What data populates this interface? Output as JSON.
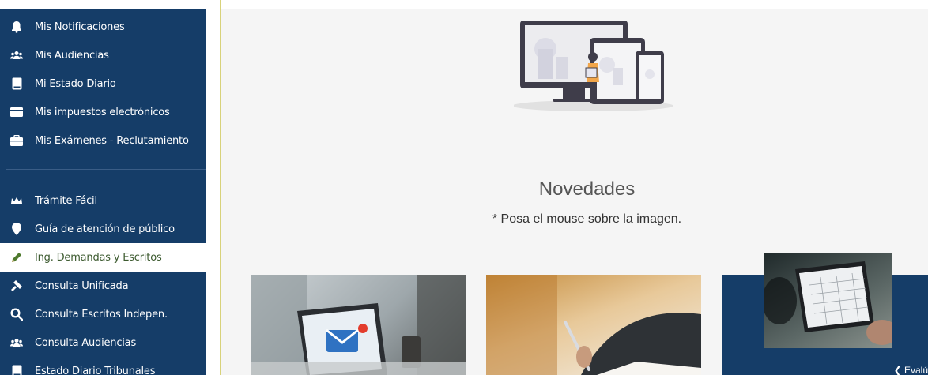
{
  "sidebar": {
    "items": [
      {
        "label": "Mis Notificaciones",
        "icon": "bell-icon"
      },
      {
        "label": "Mis Audiencias",
        "icon": "users-icon"
      },
      {
        "label": "Mi Estado Diario",
        "icon": "book-icon"
      },
      {
        "label": "Mis impuestos electrónicos",
        "icon": "credit-card-icon"
      },
      {
        "label": "Mis Exámenes - Reclutamiento",
        "icon": "briefcase-icon"
      },
      {
        "label": "Trámite Fácil",
        "icon": "crown-icon"
      },
      {
        "label": "Guía de atención de público",
        "icon": "map-marker-icon"
      },
      {
        "label": "Ing. Demandas y Escritos",
        "icon": "pencil-icon"
      },
      {
        "label": "Consulta Unificada",
        "icon": "gavel-icon"
      },
      {
        "label": "Consulta Escritos Indepen.",
        "icon": "search-icon"
      },
      {
        "label": "Consulta Audiencias",
        "icon": "users-icon"
      },
      {
        "label": "Estado Diario Tribunales",
        "icon": "book-icon"
      }
    ],
    "active_label": "Ing. Demandas y Escritos"
  },
  "main": {
    "section_title": "Novedades",
    "section_subtitle": "* Posa el mouse sobre la imagen.",
    "carousel_next_label": "Evalú"
  },
  "colors": {
    "sidebar_bg": "#153d68",
    "active_bg": "#ffffff",
    "active_text": "#3c5a2f",
    "page_bg": "#f5f5f5"
  }
}
